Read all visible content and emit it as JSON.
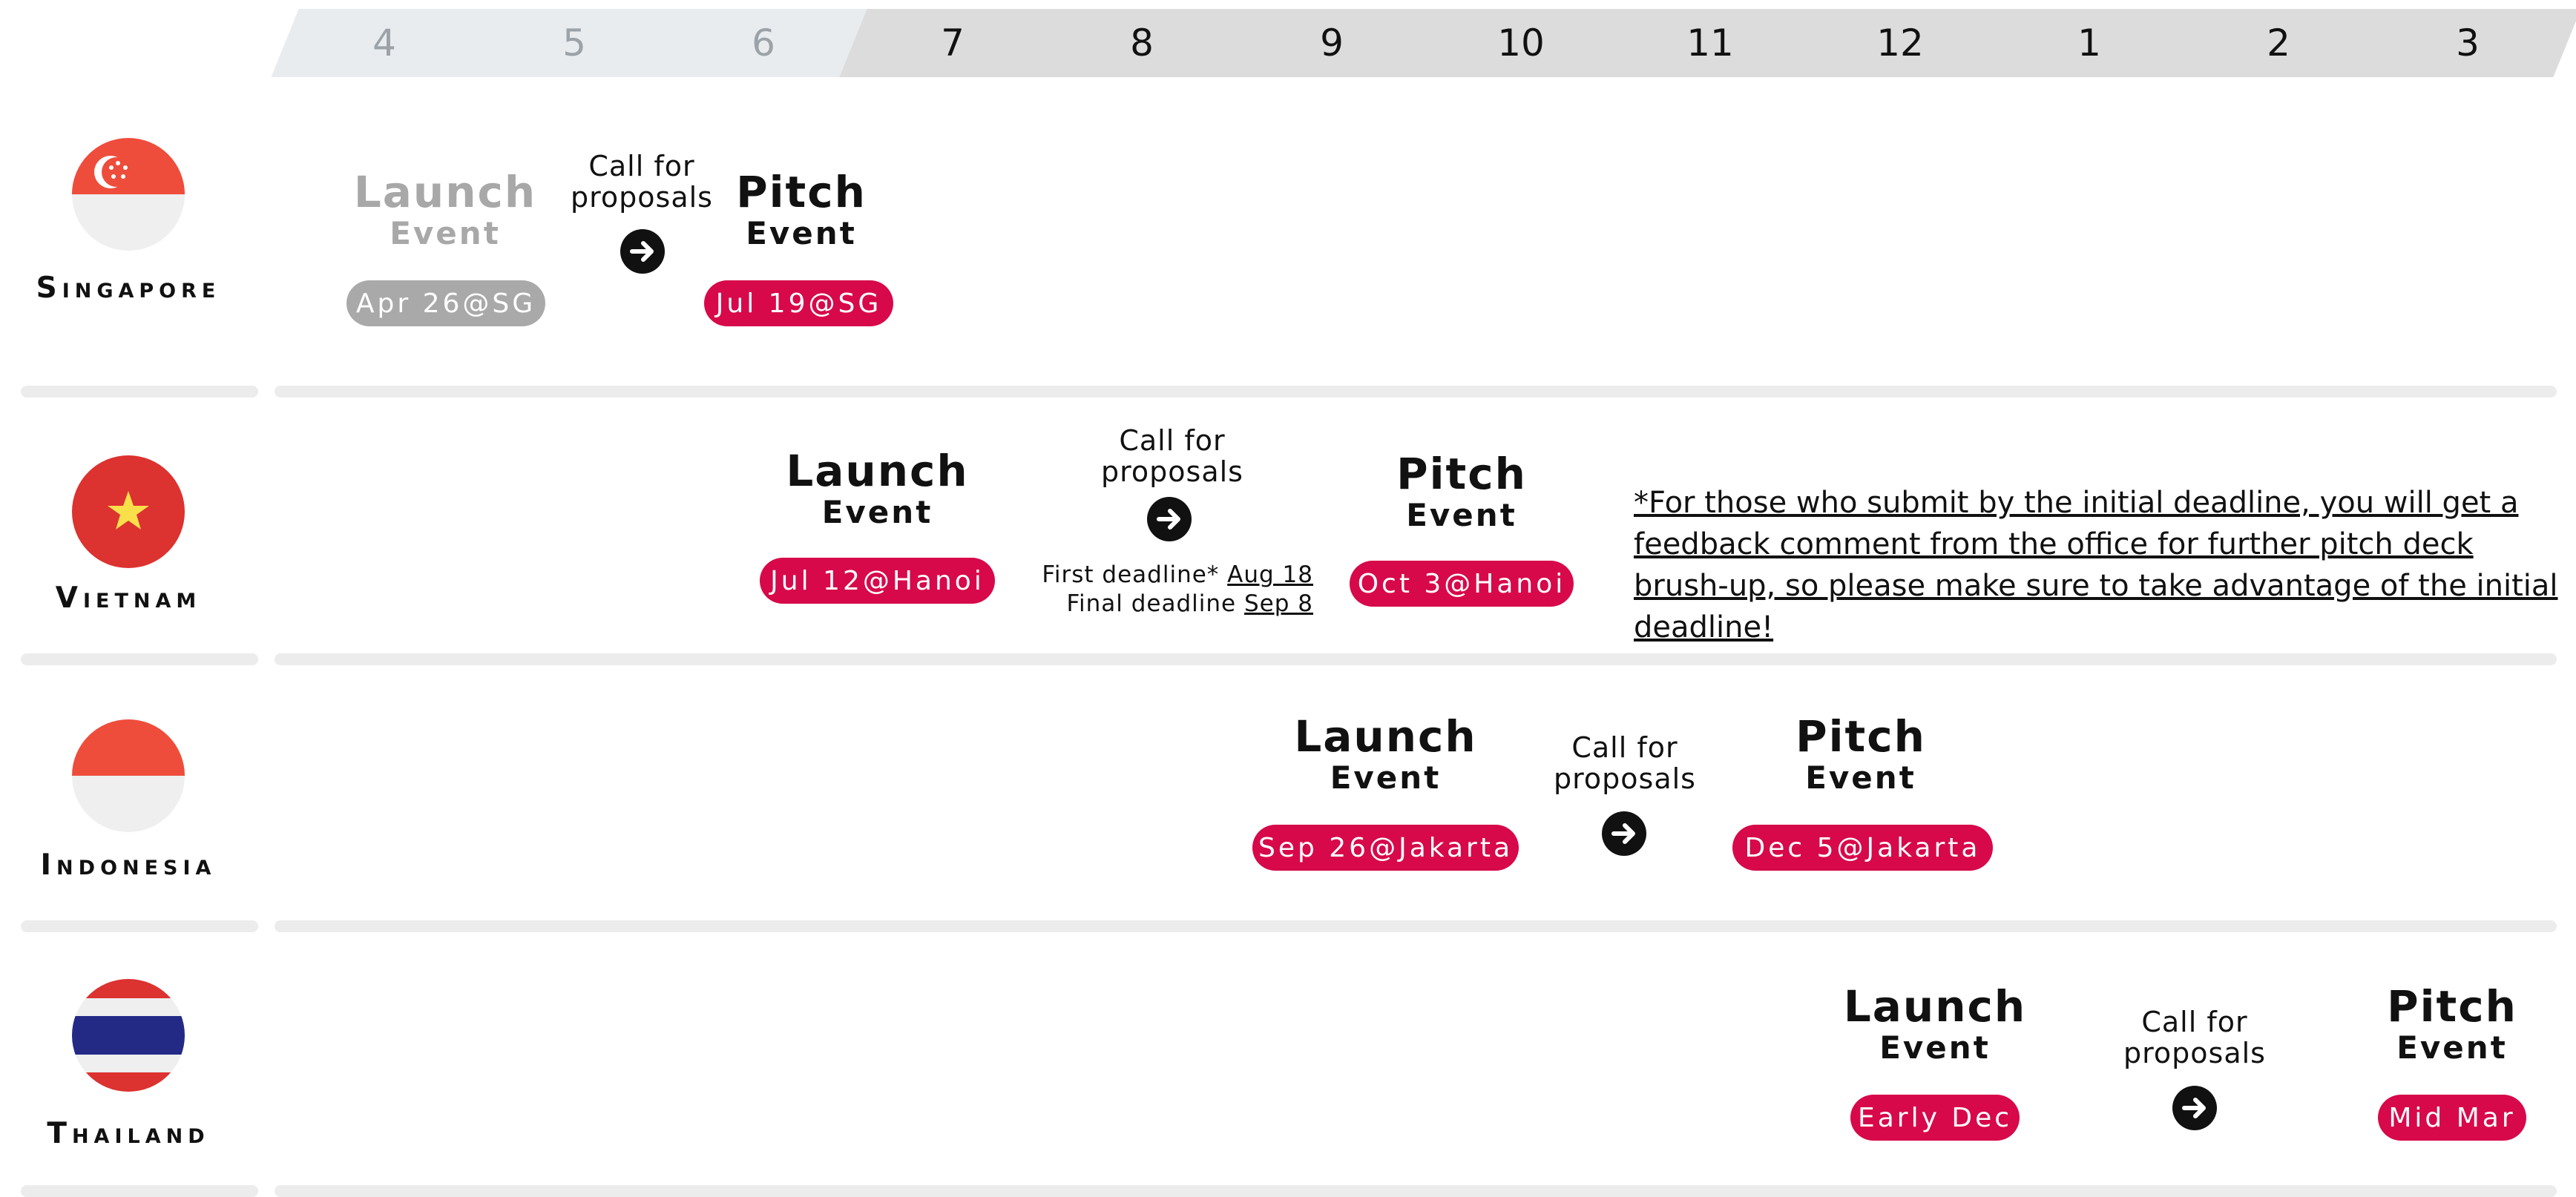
{
  "months": [
    "4",
    "5",
    "6",
    "7",
    "8",
    "9",
    "10",
    "11",
    "12",
    "1",
    "2",
    "3"
  ],
  "countries": {
    "singapore": {
      "name": "Singapore",
      "launch": {
        "title": "Launch",
        "sub": "Event",
        "date": "Apr 26@SG"
      },
      "cfp": {
        "line1": "Call for",
        "line2": "proposals"
      },
      "pitch": {
        "title": "Pitch",
        "sub": "Event",
        "date": "Jul 19@SG"
      }
    },
    "vietnam": {
      "name": "Vietnam",
      "launch": {
        "title": "Launch",
        "sub": "Event",
        "date": "Jul 12@Hanoi"
      },
      "cfp": {
        "line1": "Call for",
        "line2": "proposals"
      },
      "first_deadline_label": "First deadline*",
      "first_deadline": "Aug 18",
      "final_deadline_label": "Final deadline",
      "final_deadline": "Sep 8",
      "pitch": {
        "title": "Pitch",
        "sub": "Event",
        "date": "Oct 3@Hanoi"
      },
      "note": "*For those who submit by the initial deadline, you will get a feedback comment from the office for further pitch deck brush-up, so please make sure to take advantage of the initial deadline!"
    },
    "indonesia": {
      "name": "Indonesia",
      "launch": {
        "title": "Launch",
        "sub": "Event",
        "date": "Sep 26@Jakarta"
      },
      "cfp": {
        "line1": "Call for",
        "line2": "proposals"
      },
      "pitch": {
        "title": "Pitch",
        "sub": "Event",
        "date": "Dec 5@Jakarta"
      }
    },
    "thailand": {
      "name": "Thailand",
      "launch": {
        "title": "Launch",
        "sub": "Event",
        "date": "Early Dec"
      },
      "cfp": {
        "line1": "Call for",
        "line2": "proposals"
      },
      "pitch": {
        "title": "Pitch",
        "sub": "Event",
        "date": "Mid Mar"
      }
    }
  },
  "colors": {
    "accent": "#d7094a",
    "past_pill": "#a9a9a9",
    "header_past": "#e9ecef",
    "header_current": "#dcdcdc",
    "separator": "#ececec"
  },
  "icons": [
    "singapore-flag-icon",
    "vietnam-flag-icon",
    "indonesia-flag-icon",
    "thailand-flag-icon",
    "arrow-right-icon"
  ]
}
